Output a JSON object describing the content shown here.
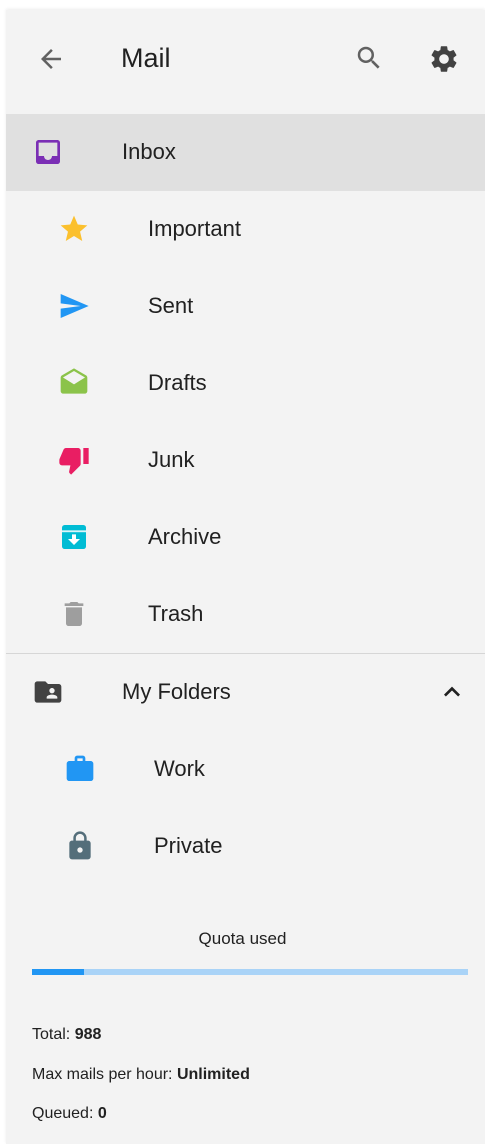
{
  "appbar": {
    "title": "Mail"
  },
  "nav": {
    "inbox": "Inbox",
    "important": "Important",
    "sent": "Sent",
    "drafts": "Drafts",
    "junk": "Junk",
    "archive": "Archive",
    "trash": "Trash"
  },
  "folders": {
    "header": "My Folders",
    "work": "Work",
    "private": "Private"
  },
  "quota": {
    "label": "Quota used",
    "used_fraction": 0.12
  },
  "stats": {
    "total_label": "Total:",
    "total_value": "988",
    "max_label": "Max mails per hour:",
    "max_value": "Unlimited",
    "queued_label": "Queued:",
    "queued_value": "0"
  },
  "colors": {
    "inbox": "#7b2fb5",
    "important": "#fbc02d",
    "sent": "#2196f3",
    "drafts": "#8bc34a",
    "junk": "#e91e63",
    "archive": "#00bcd4",
    "trash": "#9e9e9e",
    "folder": "#424242",
    "work": "#2196f3",
    "private": "#546e7a",
    "quota_fill": "#2196f3",
    "quota_track": "#a9d3f7"
  },
  "icons": {
    "back": "arrow-back-icon",
    "search": "search-icon",
    "settings": "gear-icon"
  }
}
